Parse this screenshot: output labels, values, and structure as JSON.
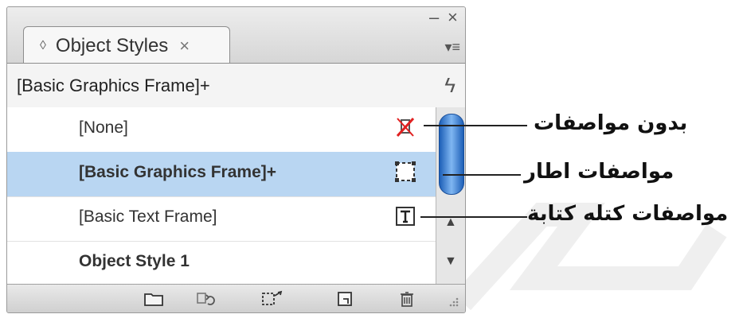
{
  "panel": {
    "minimize_glyph": "–",
    "close_glyph": "×",
    "tab": {
      "arrow_glyph": "◊",
      "title": "Object Styles",
      "close_glyph": "×"
    },
    "menu_glyph": "▾≡",
    "status_text": "[Basic Graphics Frame]+",
    "bolt_glyph": "ϟ",
    "rows": [
      {
        "label": "[None]",
        "icon": "none-style-icon",
        "bold": false,
        "selected": false
      },
      {
        "label": "[Basic Graphics Frame]+",
        "icon": "graphics-frame-icon",
        "bold": true,
        "selected": true
      },
      {
        "label": "[Basic Text Frame]",
        "icon": "text-frame-icon",
        "bold": false,
        "selected": false
      },
      {
        "label": "Object Style 1",
        "icon": "",
        "bold": true,
        "selected": false
      }
    ],
    "scrollbar": {
      "up_glyph": "▲",
      "down_glyph": "▼"
    },
    "bottom_icons": [
      "folder-icon",
      "clear-overrides-icon",
      "apply-style-icon",
      "new-style-icon",
      "trash-icon"
    ]
  },
  "callouts": [
    {
      "text": "بدون مواصفات"
    },
    {
      "text": "مواصفات اطار"
    },
    {
      "text": "مواصفات كتله كتابة"
    }
  ],
  "colors": {
    "selection": "#b9d6f2",
    "scroll_thumb": "#1d5fb7",
    "none_icon_red": "#e02020"
  }
}
